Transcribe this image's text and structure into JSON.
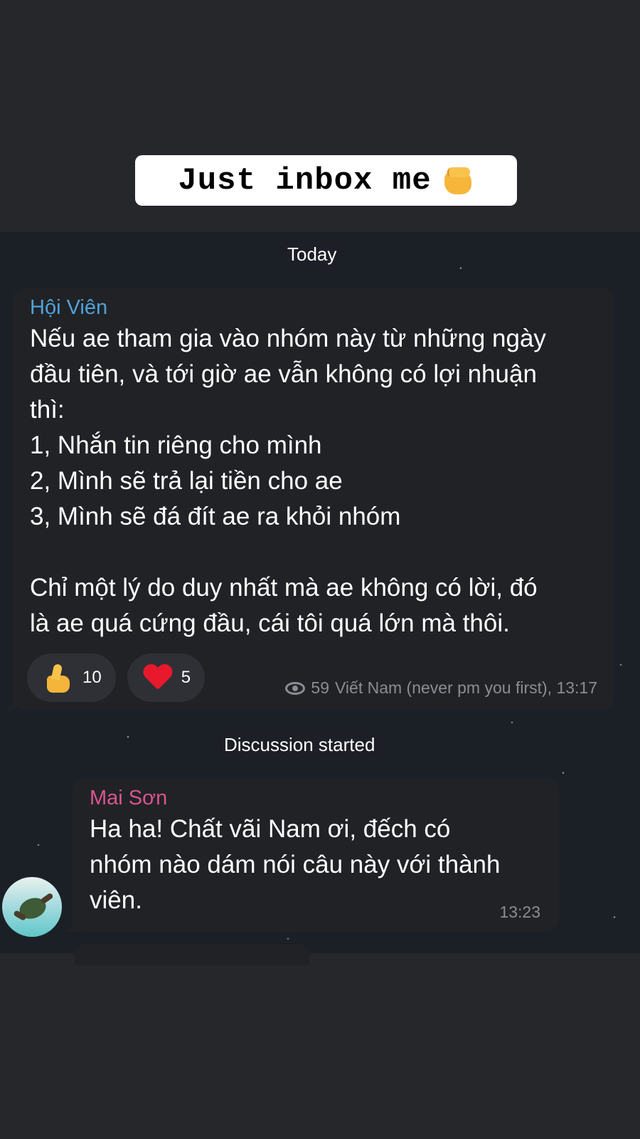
{
  "caption": {
    "text": "Just inbox me",
    "emoji": "oncoming-fist-emoji"
  },
  "chat": {
    "date_divider": "Today",
    "post": {
      "sender": "Hội Viên",
      "text": "Nếu ae tham gia vào nhóm này từ những ngày\nđầu tiên, và tới giờ ae vẫn không có lợi nhuận\nthì:\n1, Nhắn tin riêng cho mình\n2, Mình sẽ trả lại tiền cho ae\n3, Mình sẽ đá đít ae ra khỏi nhóm\n\nChỉ một lý do duy nhất mà ae không có lời, đó\nlà ae quá cứng đầu, cái tôi quá lớn mà thôi.",
      "reactions": [
        {
          "icon": "thumbs-up-emoji",
          "count": "10"
        },
        {
          "icon": "red-heart-emoji",
          "count": "5"
        }
      ],
      "views": "59",
      "signature": "Viết Nam (never pm you first), 13:17"
    },
    "service_message": "Discussion started",
    "reply": {
      "sender": "Mai Sơn",
      "text": "Ha ha! Chất vãi Nam ơi, đếch có\nnhóm nào dám nói câu này với thành\nviên.",
      "time": "13:23"
    }
  },
  "colors": {
    "page_bg": "#26272b",
    "bubble_bg": "#212226",
    "sender_blue": "#4fa3d9",
    "sender_pink": "#d9558f",
    "meta_gray": "#8a8d93"
  }
}
